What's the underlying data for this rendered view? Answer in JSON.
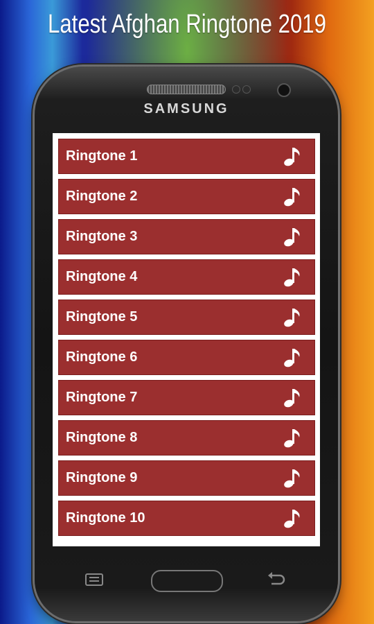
{
  "header": {
    "title": "Latest Afghan Ringtone 2019"
  },
  "device": {
    "brand": "SAMSUNG"
  },
  "ringtones": [
    {
      "label": "Ringtone 1",
      "icon": "music-note-icon"
    },
    {
      "label": "Ringtone 2",
      "icon": "music-note-icon"
    },
    {
      "label": "Ringtone 3",
      "icon": "music-note-icon"
    },
    {
      "label": "Ringtone 4",
      "icon": "music-note-icon"
    },
    {
      "label": "Ringtone 5",
      "icon": "music-note-icon"
    },
    {
      "label": "Ringtone 6",
      "icon": "music-note-icon"
    },
    {
      "label": "Ringtone 7",
      "icon": "music-note-icon"
    },
    {
      "label": "Ringtone 8",
      "icon": "music-note-icon"
    },
    {
      "label": "Ringtone 9",
      "icon": "music-note-icon"
    },
    {
      "label": "Ringtone 10",
      "icon": "music-note-icon"
    }
  ],
  "colors": {
    "item_bg": "#9b2f2f",
    "item_text": "#ffffff"
  },
  "nav_icons": [
    "menu-icon",
    "home-button",
    "back-icon"
  ]
}
